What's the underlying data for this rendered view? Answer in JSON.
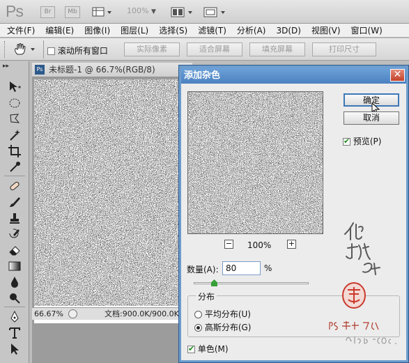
{
  "app": {
    "logo": "Ps",
    "tb_br": "Br",
    "tb_mb": "Mb",
    "zoom_display": "100%"
  },
  "menu": [
    "文件(F)",
    "编辑(E)",
    "图像(I)",
    "图层(L)",
    "选择(S)",
    "滤镜(T)",
    "分析(A)",
    "3D(D)",
    "视图(V)",
    "窗口(W)"
  ],
  "options": {
    "scroll_all_label": "滚动所有窗口",
    "scroll_all_checked": false,
    "buttons": [
      "实际像素",
      "适合屏幕",
      "填充屏幕",
      "打印尺寸"
    ]
  },
  "document": {
    "tab_title": "未标题-1 @ 66.7%(RGB/8)",
    "zoom": "66.67%",
    "status": "文档:900.0K/900.0K"
  },
  "dialog": {
    "title": "添加杂色",
    "ok_label": "确定",
    "cancel_label": "取消",
    "preview_label": "预览(P)",
    "preview_checked": true,
    "preview_zoom": "100%",
    "amount_label": "数量(A):",
    "amount_value": "80",
    "amount_unit": "%",
    "amount_slider_fraction": 0.16,
    "distribution_title": "分布",
    "uniform_label": "平均分布(U)",
    "gaussian_label": "高斯分布(G)",
    "selected_distribution": "gaussian",
    "mono_label": "单色(M)",
    "mono_checked": true
  },
  "colors": {
    "title_bar": "#4b81c0",
    "close_button": "#c2412a",
    "watermark": "#b03a2a",
    "stamp": "#c9382a"
  }
}
